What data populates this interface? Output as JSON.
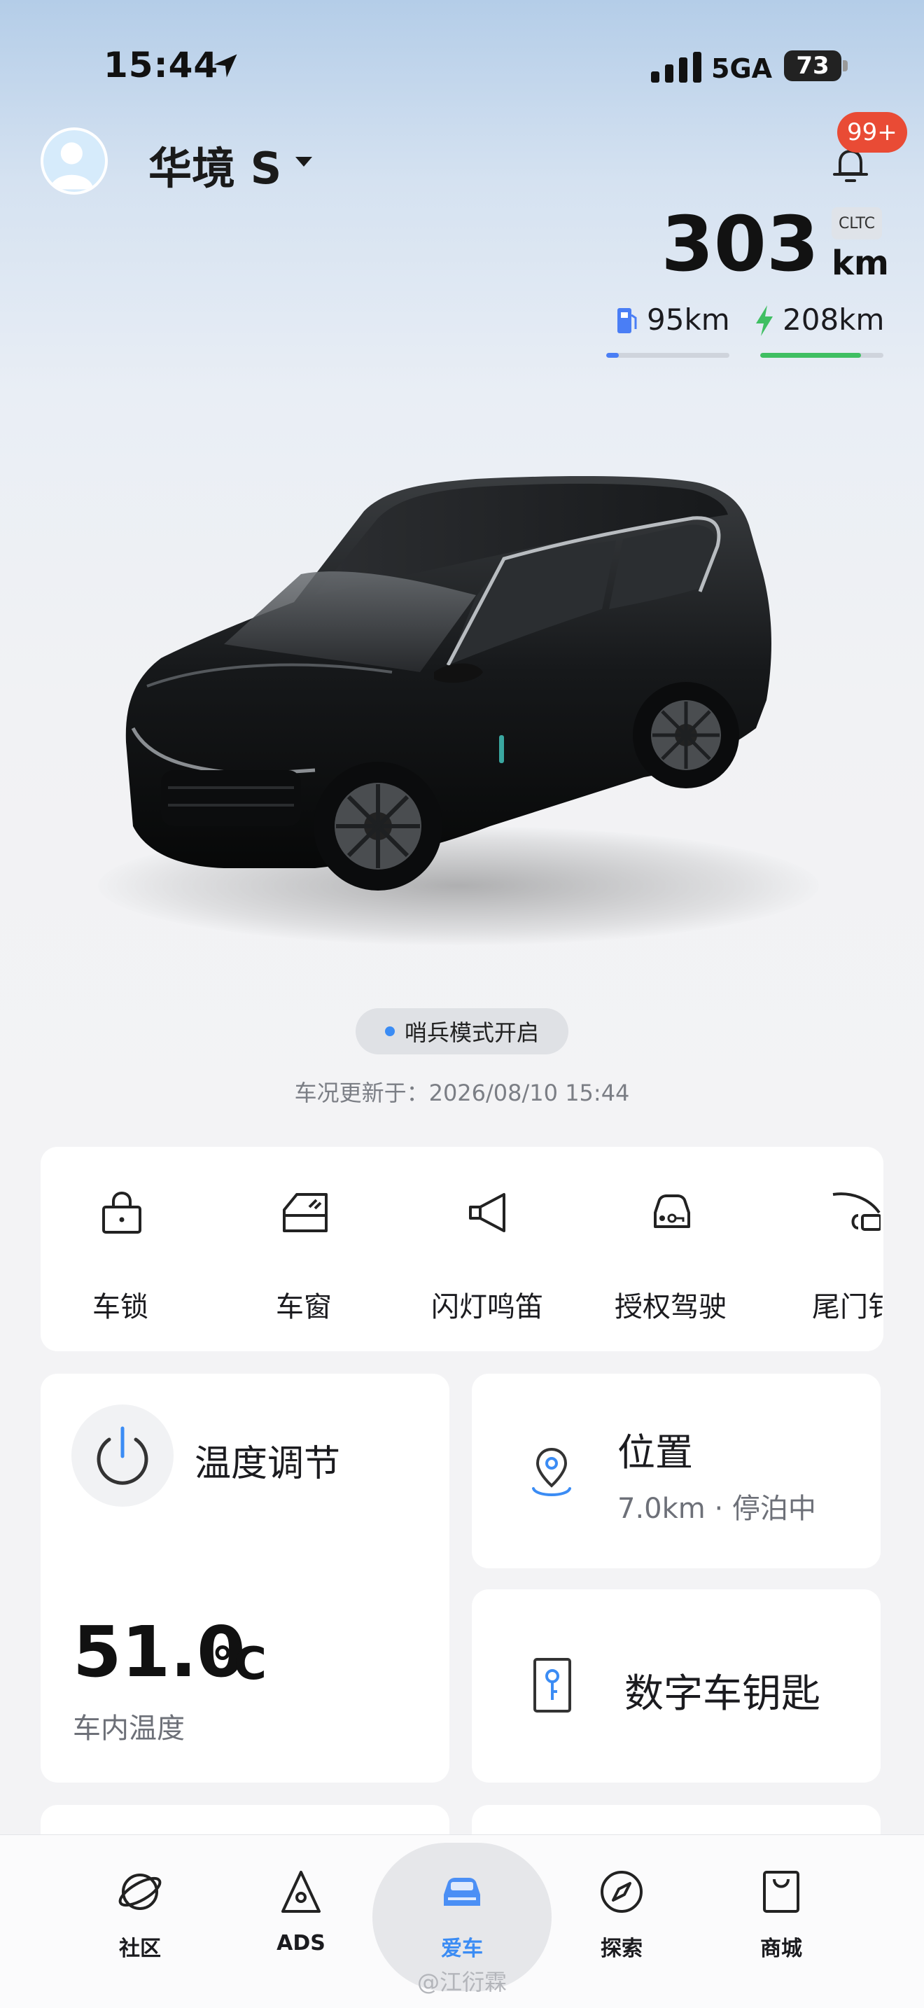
{
  "status_bar": {
    "time": "15:44",
    "network": "5GA",
    "battery": "73"
  },
  "header": {
    "car_name": "华境 S",
    "notification_badge": "99+"
  },
  "range": {
    "total": "303",
    "unit": "km",
    "standard": "CLTC",
    "fuel": "95km",
    "fuel_fraction": 0.1,
    "electric": "208km",
    "electric_fraction": 0.82,
    "fuel_color": "#4a7ef5",
    "electric_color": "#3fbf62"
  },
  "status": {
    "sentry": "哨兵模式开启",
    "updated": "车况更新于：2026/08/10 15:44"
  },
  "controls": [
    {
      "label": "车锁",
      "icon": "lock-icon"
    },
    {
      "label": "车窗",
      "icon": "window-icon"
    },
    {
      "label": "闪灯鸣笛",
      "icon": "horn-icon"
    },
    {
      "label": "授权驾驶",
      "icon": "authorized-drive-icon"
    },
    {
      "label": "尾门钅",
      "icon": "tailgate-icon"
    }
  ],
  "climate": {
    "title": "温度调节",
    "temperature": "51.0",
    "unit": "°C",
    "caption": "车内温度"
  },
  "location": {
    "title": "位置",
    "detail": "7.0km · 停泊中"
  },
  "digital_key": {
    "title": "数字车钥匙"
  },
  "tabs": [
    {
      "label": "社区",
      "icon": "community-icon",
      "active": false
    },
    {
      "label": "ADS",
      "icon": "ads-icon",
      "active": false
    },
    {
      "label": "爱车",
      "icon": "car-icon",
      "active": true
    },
    {
      "label": "探索",
      "icon": "compass-icon",
      "active": false
    },
    {
      "label": "商城",
      "icon": "shop-bag-icon",
      "active": false
    }
  ],
  "watermark": "@江衍霖",
  "accent_color": "#3b8cf4"
}
